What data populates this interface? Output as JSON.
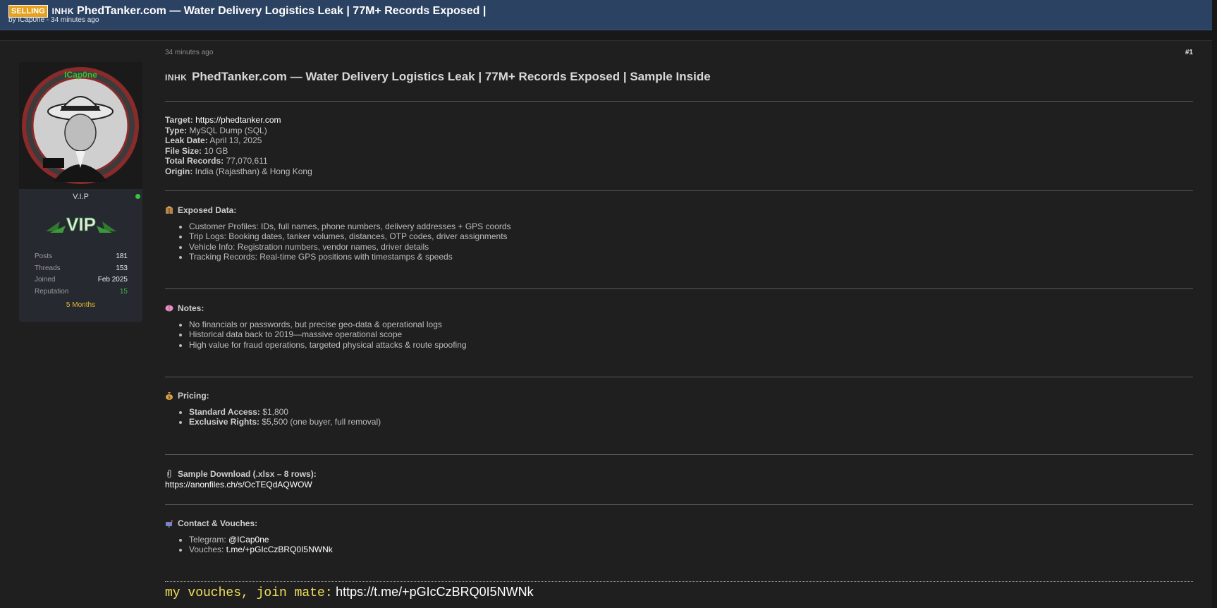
{
  "thread": {
    "badge": "SELLING",
    "country_code": "INHK",
    "title": "PhedTanker.com — Water Delivery Logistics Leak | 77M+ Records Exposed |",
    "byline": "by ICap0ne - 34 minutes ago"
  },
  "user": {
    "username": "ICap0ne",
    "rank": "V.I.P",
    "vip_text": "VIP",
    "stats": [
      {
        "label": "Posts",
        "value": "181"
      },
      {
        "label": "Threads",
        "value": "153"
      },
      {
        "label": "Joined",
        "value": "Feb 2025"
      },
      {
        "label": "Reputation",
        "value": "15"
      }
    ],
    "membership": "5 Months"
  },
  "post": {
    "timestamp": "34 minutes ago",
    "number": "#1",
    "country_code": "INHK",
    "heading": "PhedTanker.com — Water Delivery Logistics Leak | 77M+ Records Exposed | Sample Inside",
    "details": {
      "target_label": "Target:",
      "target_value": "https://phedtanker.com",
      "type_label": "Type:",
      "type_value": "MySQL Dump (SQL)",
      "leak_label": "Leak Date:",
      "leak_value": "April 13, 2025",
      "size_label": "File Size:",
      "size_value": "10 GB",
      "records_label": "Total Records:",
      "records_value": "77,070,611",
      "origin_label": "Origin:",
      "origin_value": "India (Rajasthan) & Hong Kong"
    },
    "exposed": {
      "title": "Exposed Data:",
      "items": [
        "Customer Profiles: IDs, full names, phone numbers, delivery addresses + GPS coords",
        "Trip Logs: Booking dates, tanker volumes, distances, OTP codes, driver assignments",
        "Vehicle Info: Registration numbers, vendor names, driver details",
        "Tracking Records: Real-time GPS positions with timestamps & speeds"
      ]
    },
    "notes": {
      "title": "Notes:",
      "items": [
        "No financials or passwords, but precise geo-data & operational logs",
        "Historical data back to 2019—massive operational scope",
        "High value for fraud operations, targeted physical attacks & route spoofing"
      ]
    },
    "pricing": {
      "title": "Pricing:",
      "standard_label": "Standard Access:",
      "standard_value": "$1,800",
      "exclusive_label": "Exclusive Rights:",
      "exclusive_value": "$5,500 (one buyer, full removal)"
    },
    "sample": {
      "title": "Sample Download (.xlsx – 8 rows):",
      "link": "https://anonfiles.ch/s/OcTEQdAQWOW"
    },
    "contact": {
      "title": "Contact & Vouches:",
      "telegram_label": "Telegram:",
      "telegram_value": "@ICap0ne",
      "vouches_label": "Vouches:",
      "vouches_value": "t.me/+pGIcCzBRQ0I5NWNk"
    },
    "footer": {
      "text": "my vouches, join mate:",
      "link": "https://t.me/+pGIcCzBRQ0I5NWNk"
    }
  },
  "colors": {
    "header_bg": "#2c4262",
    "badge_bg": "#e6a21f",
    "vip_green": "#46b446",
    "months_gold": "#e8b730",
    "signature_yellow": "#f2e05a"
  }
}
